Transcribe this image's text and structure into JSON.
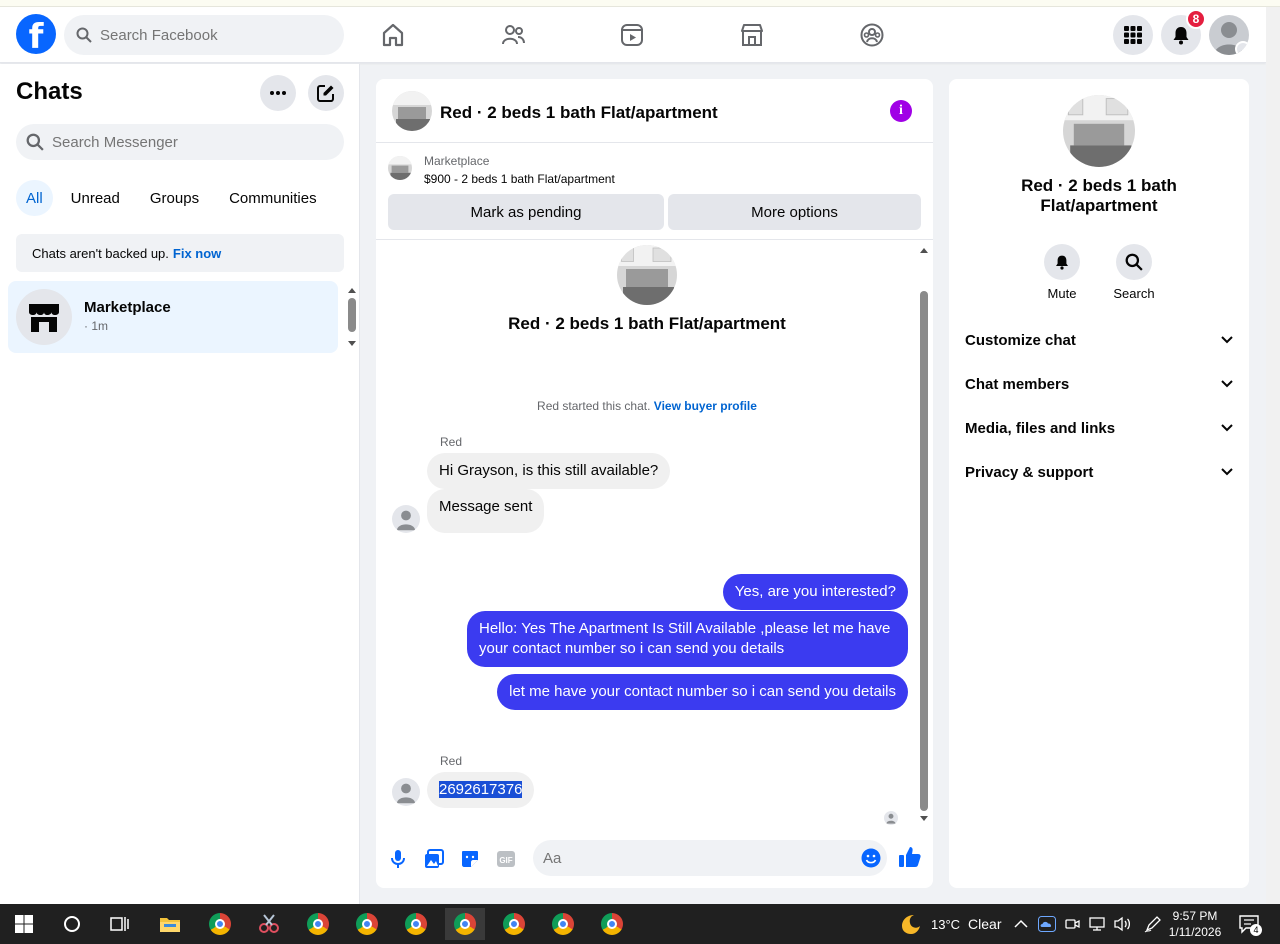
{
  "topnav": {
    "logo": "f",
    "search_placeholder": "Search Facebook",
    "notification_count": "8"
  },
  "left": {
    "title": "Chats",
    "search_placeholder": "Search Messenger",
    "filters": [
      "All",
      "Unread",
      "Groups",
      "Communities"
    ],
    "backup_text": "Chats aren't backed up.",
    "backup_link": "Fix now",
    "chat": {
      "name": "Marketplace",
      "time": "· 1m"
    }
  },
  "conversation": {
    "title": "Red · 2 beds 1 bath Flat/apartment",
    "info": "i",
    "marketplace_label": "Marketplace",
    "listing": "$900 - 2 beds 1 bath Flat/apartment",
    "mark_pending": "Mark as pending",
    "more_options": "More options",
    "thread_title": "Red · 2 beds 1 bath Flat/apartment",
    "started_text": "Red started this chat.",
    "buyer_link": "View buyer profile",
    "sender1": "Red",
    "msg1": "Hi Grayson, is this still available?",
    "msg2": "Message sent",
    "out1": "Yes, are you interested?",
    "out2": "Hello: Yes The Apartment Is Still Available ,please let me have your contact number so i can send you details",
    "out3": "let me have your contact number so i can send you details",
    "sender2": "Red",
    "msg3": "2692617376",
    "composer_placeholder": "Aa"
  },
  "right": {
    "title": "Red · 2 beds 1 bath Flat/apartment",
    "mute": "Mute",
    "search": "Search",
    "sections": [
      "Customize chat",
      "Chat members",
      "Media, files and links",
      "Privacy & support"
    ]
  },
  "taskbar": {
    "temperature": "13°C",
    "weather": "Clear",
    "time": "9:57 PM",
    "date": "1/11/2026",
    "notifications": "4"
  },
  "colors": {
    "brand": "#0866ff",
    "outgoing": "#3b3bf0",
    "info": "#a000e6",
    "badge": "#e41e3f"
  }
}
